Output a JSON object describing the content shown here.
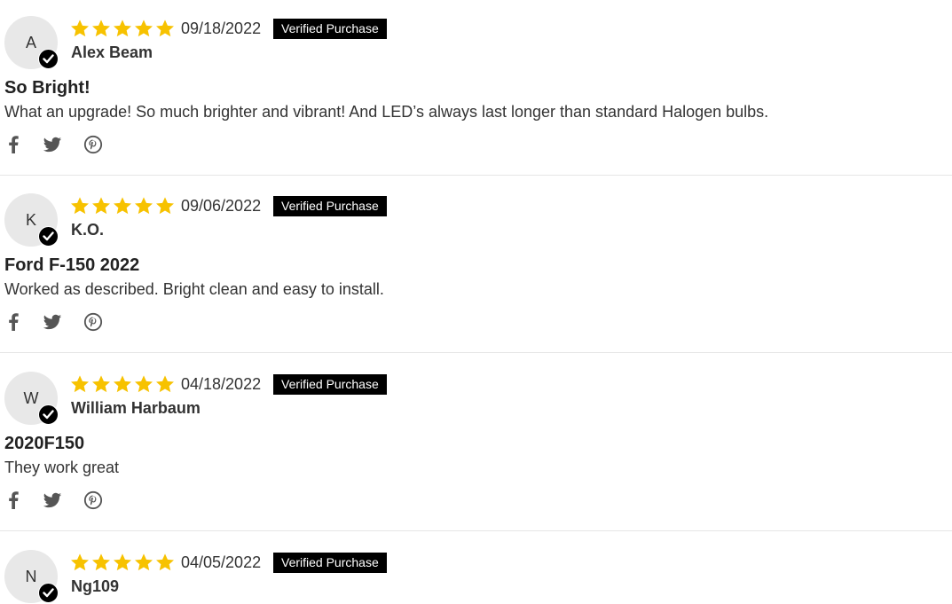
{
  "colors": {
    "star": "#f7c200",
    "badge_bg": "#000000",
    "badge_text": "#ffffff",
    "avatar_bg": "#e8e8e8",
    "icon": "#555555",
    "divider": "#e6e6e6"
  },
  "reviews": [
    {
      "avatar_letter": "A",
      "rating": 5,
      "date": "09/18/2022",
      "badge": "Verified Purchase",
      "reviewer": "Alex Beam",
      "title": "So Bright!",
      "body": "What an upgrade! So much brighter and vibrant! And LED’s always last longer than standard Halogen bulbs.",
      "share_icons": [
        "facebook-icon",
        "twitter-icon",
        "pinterest-icon"
      ]
    },
    {
      "avatar_letter": "K",
      "rating": 5,
      "date": "09/06/2022",
      "badge": "Verified Purchase",
      "reviewer": "K.O.",
      "title": "Ford F-150 2022",
      "body": "Worked as described. Bright clean and easy to install.",
      "share_icons": [
        "facebook-icon",
        "twitter-icon",
        "pinterest-icon"
      ]
    },
    {
      "avatar_letter": "W",
      "rating": 5,
      "date": "04/18/2022",
      "badge": "Verified Purchase",
      "reviewer": "William Harbaum",
      "title": "2020F150",
      "body": "They work great",
      "share_icons": [
        "facebook-icon",
        "twitter-icon",
        "pinterest-icon"
      ]
    },
    {
      "avatar_letter": "N",
      "rating": 5,
      "date": "04/05/2022",
      "badge": "Verified Purchase",
      "reviewer": "Ng109",
      "title": "",
      "body": "",
      "share_icons": []
    }
  ]
}
